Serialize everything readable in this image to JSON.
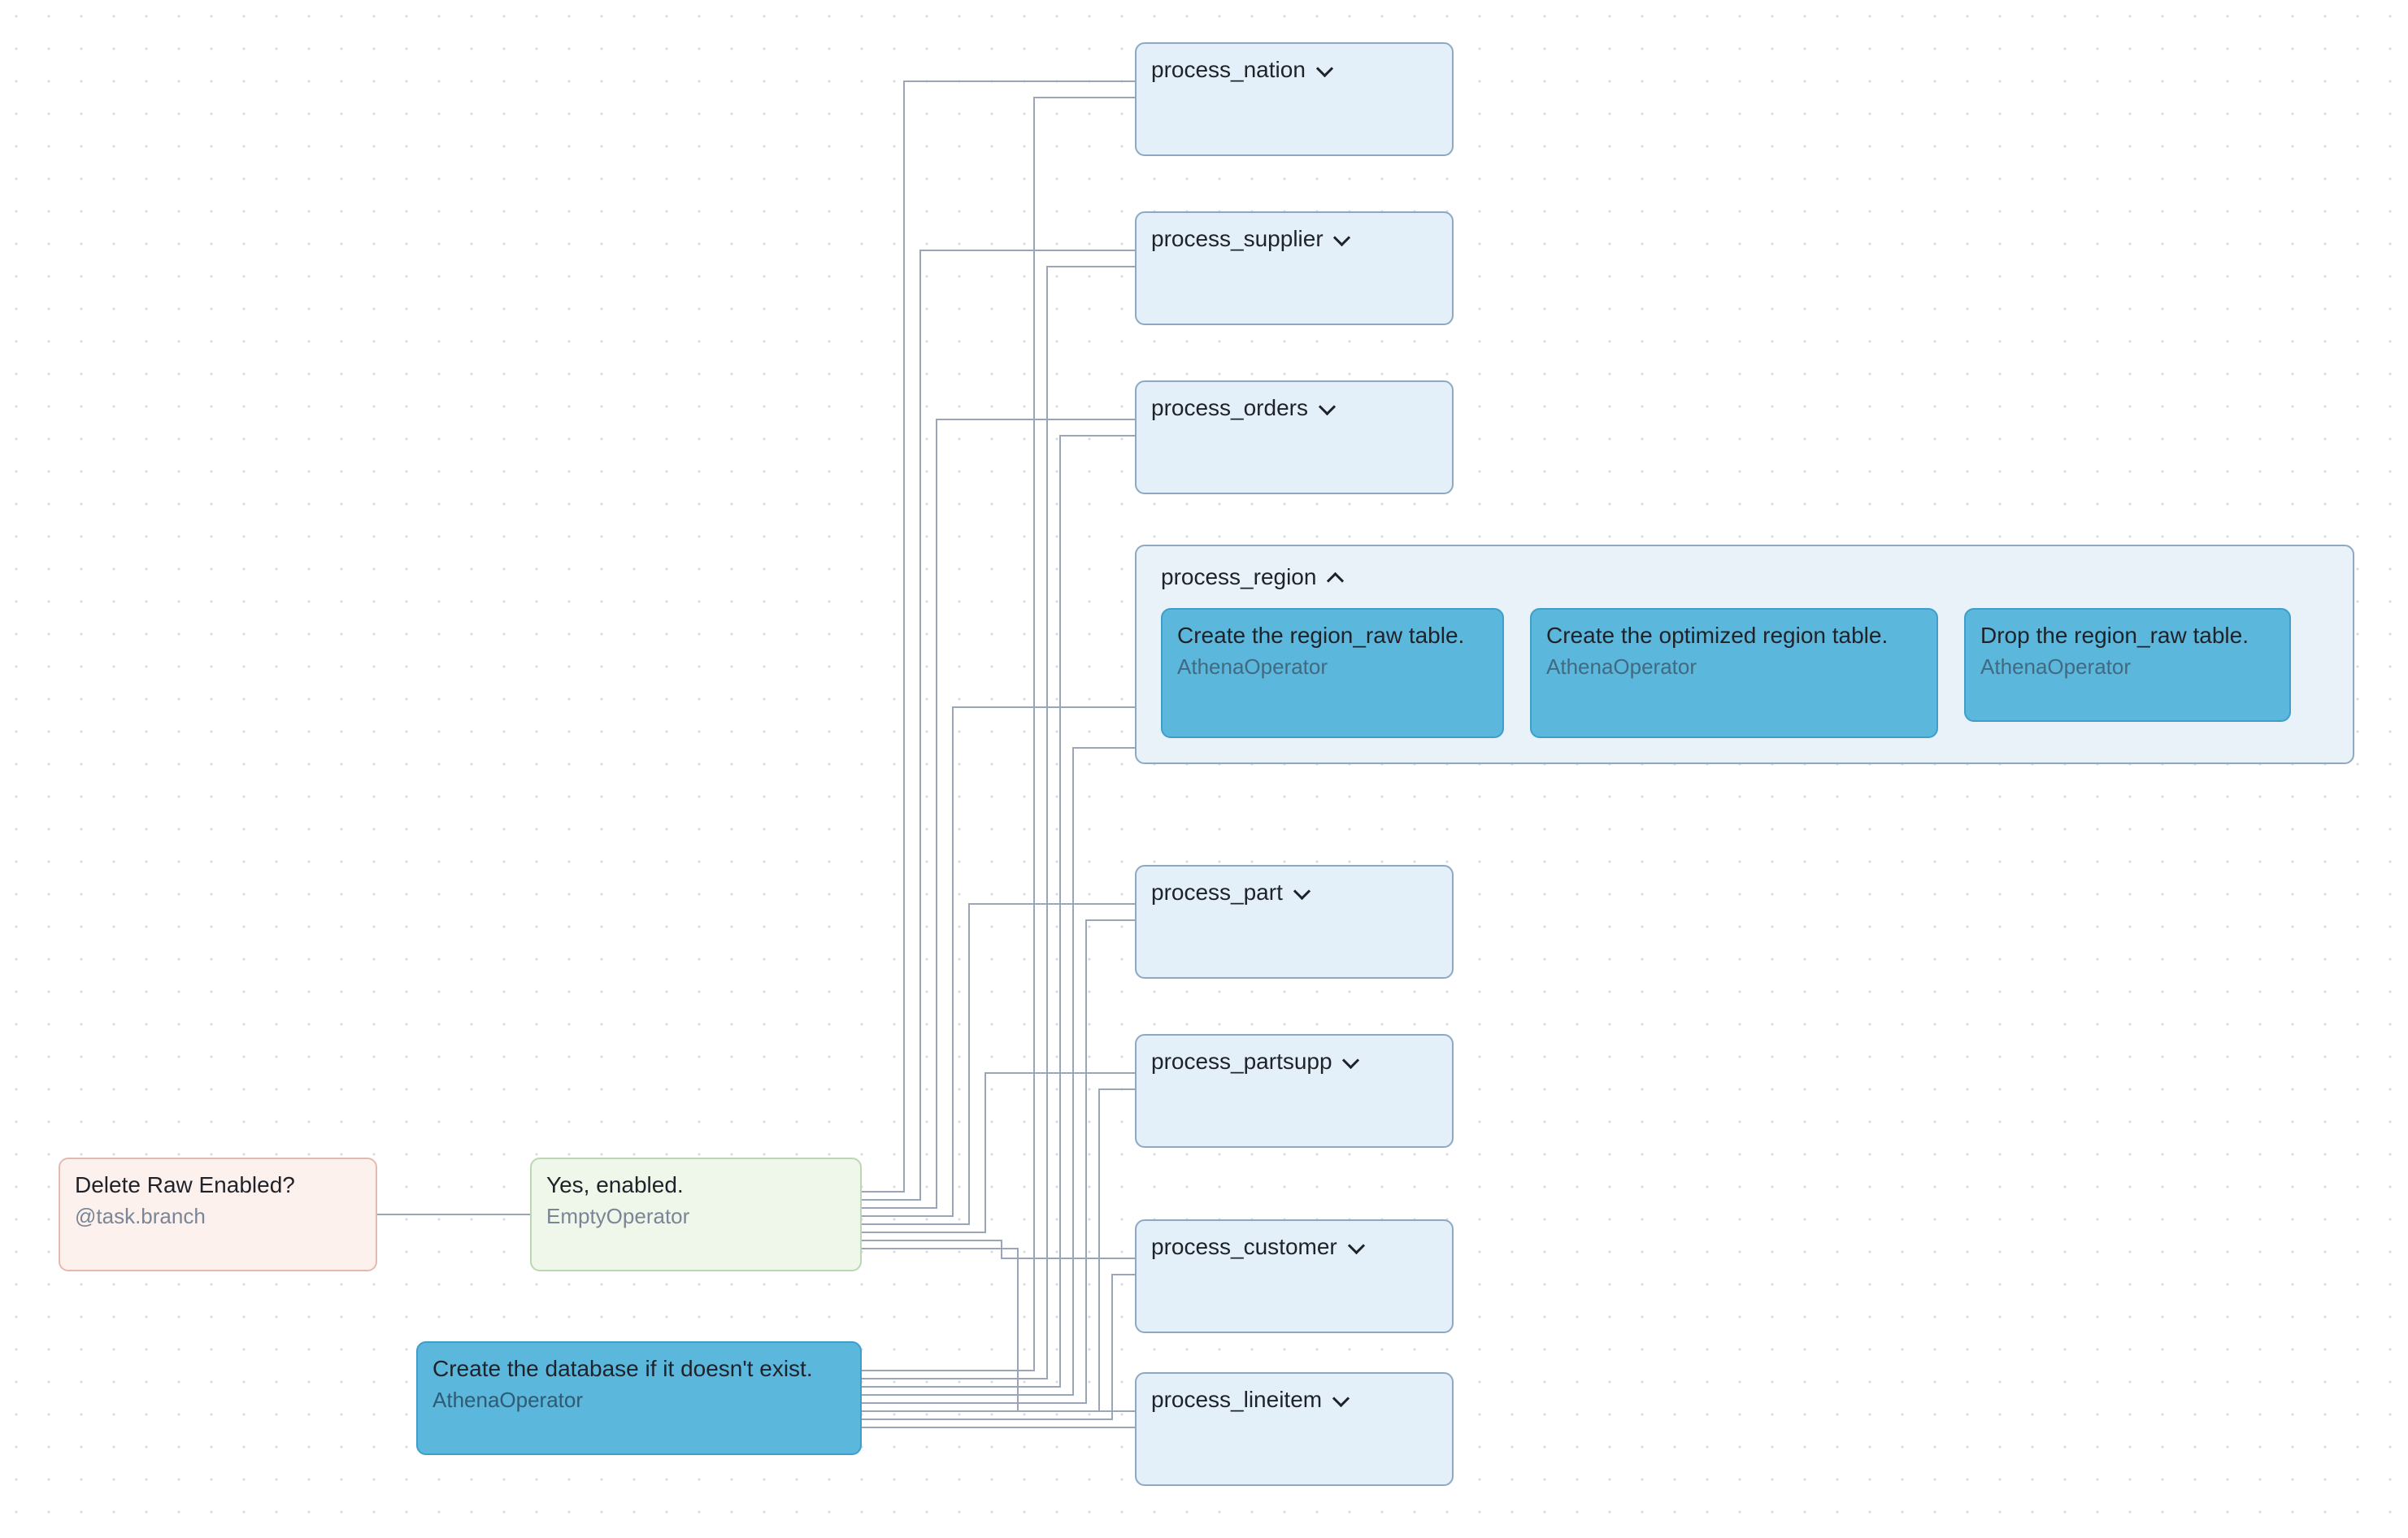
{
  "nodes": {
    "delete_raw": {
      "title": "Delete Raw Enabled?",
      "subtitle": "@task.branch"
    },
    "yes_enabled": {
      "title": "Yes, enabled.",
      "subtitle": "EmptyOperator"
    },
    "create_db": {
      "title": "Create the database if it doesn't exist.",
      "subtitle": "AthenaOperator"
    },
    "process_nation": {
      "title": "process_nation"
    },
    "process_supplier": {
      "title": "process_supplier"
    },
    "process_orders": {
      "title": "process_orders"
    },
    "process_region": {
      "title": "process_region",
      "children": {
        "create_raw": {
          "title": "Create the region_raw table.",
          "subtitle": "AthenaOperator"
        },
        "create_opt": {
          "title": "Create the optimized region table.",
          "subtitle": "AthenaOperator"
        },
        "drop_raw": {
          "title": "Drop the region_raw table.",
          "subtitle": "AthenaOperator"
        }
      }
    },
    "process_part": {
      "title": "process_part"
    },
    "process_partsupp": {
      "title": "process_partsupp"
    },
    "process_customer": {
      "title": "process_customer"
    },
    "process_lineitem": {
      "title": "process_lineitem"
    }
  }
}
